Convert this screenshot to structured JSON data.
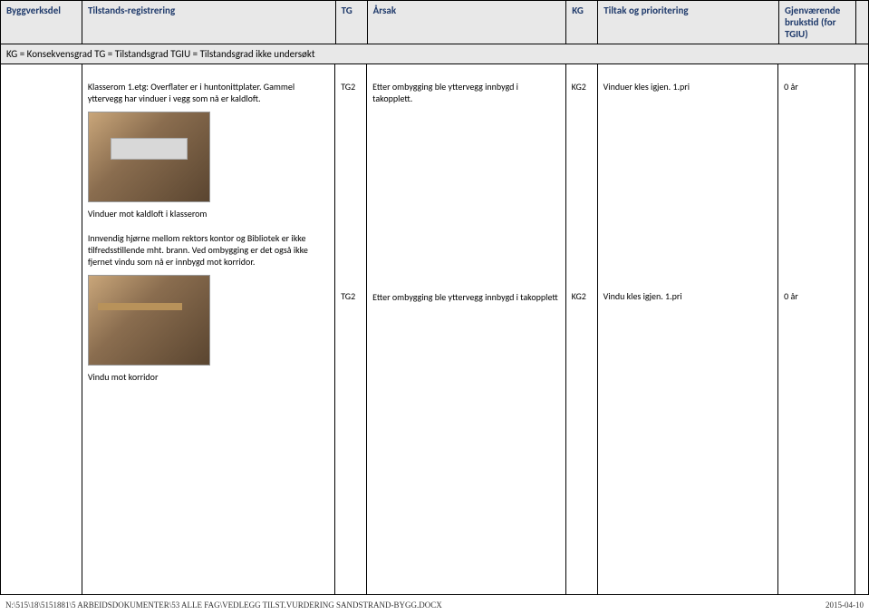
{
  "header": {
    "cols": {
      "byggverksdel": "Byggverksdel",
      "tilstand": "Tilstands-registrering",
      "tg": "TG",
      "arsak": "Årsak",
      "kg": "KG",
      "tiltak": "Tiltak og prioritering",
      "brukstid": "Gjenværende brukstid (for TGIU)"
    },
    "legend": "KG = Konsekvensgrad  TG = Tilstandsgrad  TGIU = Tilstandsgrad ikke undersøkt"
  },
  "row1": {
    "tilstand": "Klasserom 1.etg: Overflater er i huntonittplater. Gammel yttervegg har vinduer i vegg som nå er kaldloft.",
    "tg": "TG2",
    "arsak": "Etter ombygging ble yttervegg innbygd i takopplett.",
    "kg": "KG2",
    "tiltak": "Vinduer kles igjen. 1.pri",
    "brukstid": "0 år",
    "caption": "Vinduer mot kaldloft i klasserom"
  },
  "row2": {
    "tilstand": "Innvendig hjørne mellom rektors kontor og Bibliotek er ikke tilfredsstillende mht. brann. Ved ombygging er det også ikke fjernet vindu som nå er innbygd mot korridor.",
    "tg": "TG2",
    "arsak": "Etter ombygging ble yttervegg innbygd i takopplett",
    "kg": "KG2",
    "tiltak": "Vindu kles igjen. 1.pri",
    "brukstid": "0 år",
    "caption": "Vindu mot korridor"
  },
  "footer": {
    "path": "N:\\515\\18\\5151881\\5 ARBEIDSDOKUMENTER\\53 ALLE FAG\\VEDLEGG TILST.VURDERING SANDSTRAND-BYGG.DOCX",
    "date": "2015-04-10"
  }
}
